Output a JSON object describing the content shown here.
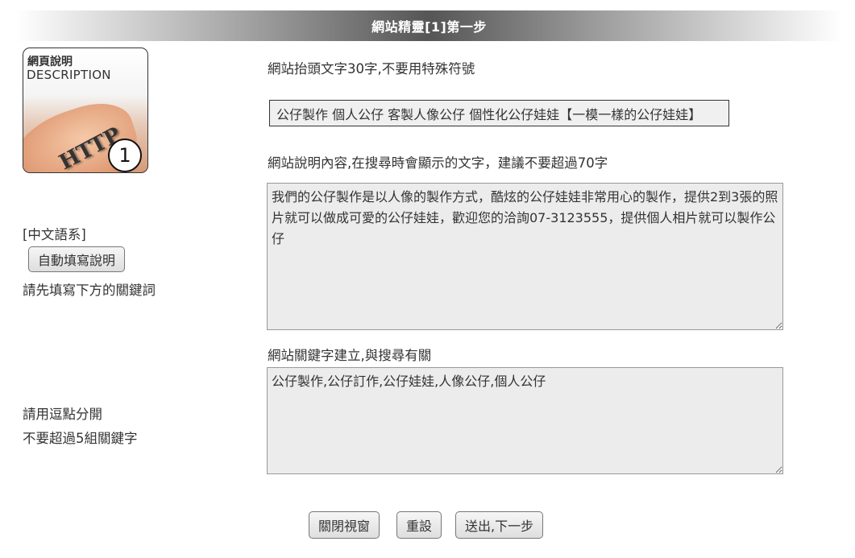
{
  "header": {
    "title": "網站精靈[1]第一步"
  },
  "logo": {
    "line1": "網頁說明",
    "line2": "DESCRIPTION",
    "watermark_text": "HTTP",
    "step_number": "1"
  },
  "left": {
    "language_label": "[中文語系]",
    "auto_fill_button": "自動填寫說明",
    "auto_fill_hint": "請先填寫下方的關鍵詞",
    "keyword_hint_1": "請用逗點分開",
    "keyword_hint_2": "不要超過5組關鍵字"
  },
  "form": {
    "title_label": "網站抬頭文字30字,不要用特殊符號",
    "title_value": "公仔製作 個人公仔 客製人像公仔 個性化公仔娃娃【一模一樣的公仔娃娃】",
    "description_label": "網站說明內容,在搜尋時會顯示的文字，建議不要超過70字",
    "description_value": "我們的公仔製作是以人像的製作方式，酷炫的公仔娃娃非常用心的製作，提供2到3張的照片就可以做成可愛的公仔娃娃，歡迎您的洽詢07-3123555，提供個人相片就可以製作公仔",
    "keywords_label": "網站關鍵字建立,與搜尋有關",
    "keywords_value": "公仔製作,公仔訂作,公仔娃娃,人像公仔,個人公仔"
  },
  "actions": {
    "close": "關閉視窗",
    "reset": "重設",
    "submit": "送出,下一步"
  }
}
